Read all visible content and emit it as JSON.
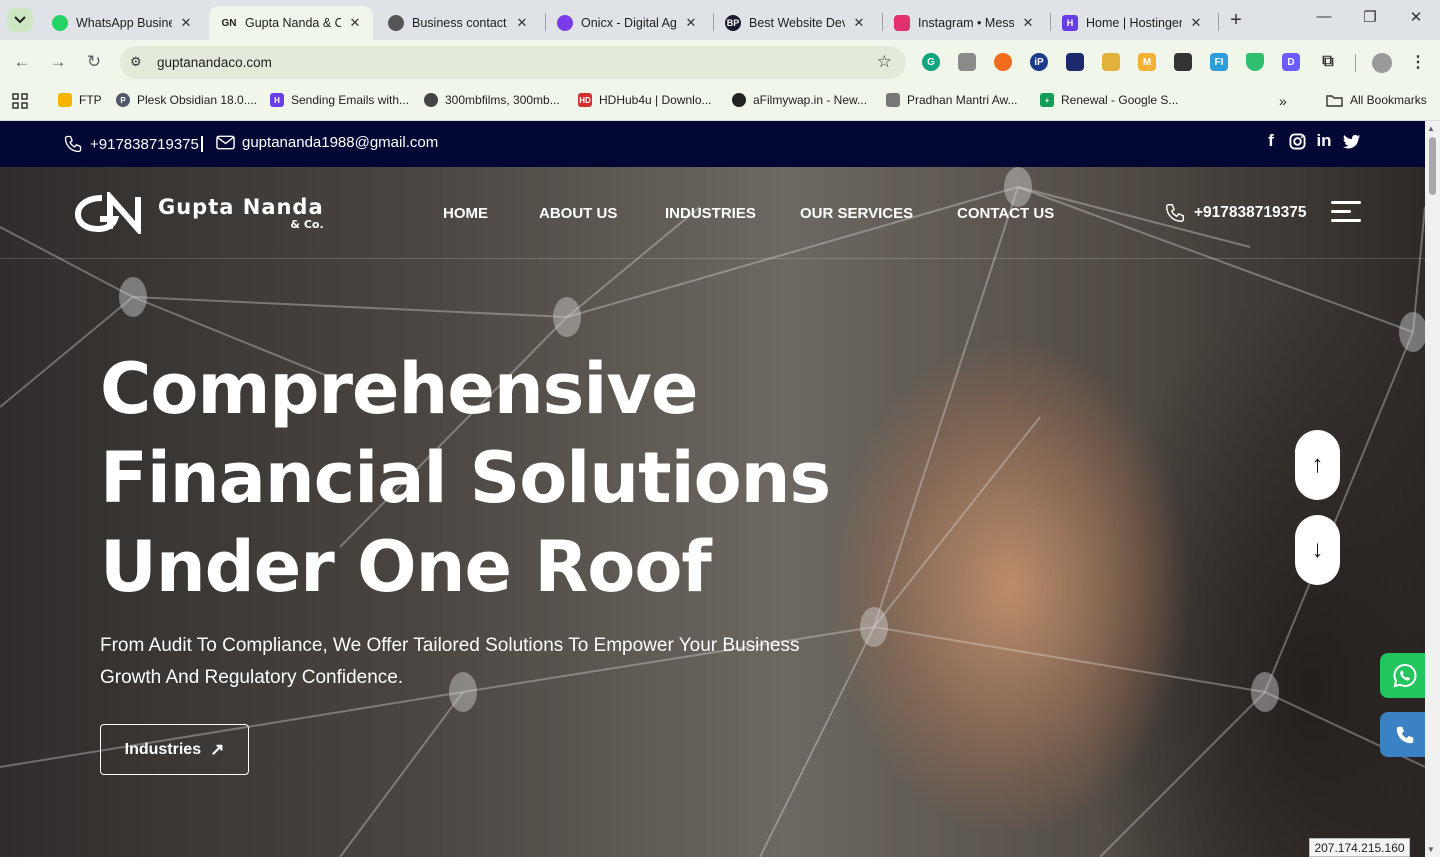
{
  "browser": {
    "tabs": [
      {
        "title": "WhatsApp Busines",
        "favicon": "whatsapp-icon",
        "color": "#25d366"
      },
      {
        "title": "Gupta Nanda & Co",
        "favicon": "gn-logo-icon",
        "color": "#222222",
        "active": true
      },
      {
        "title": "Business contact in",
        "favicon": "openai-icon",
        "color": "#333333"
      },
      {
        "title": "Onicx - Digital Age",
        "favicon": "onicx-icon",
        "color": "#7c3aed"
      },
      {
        "title": "Best Website Deve",
        "favicon": "bp-icon",
        "color": "#1a1a2e"
      },
      {
        "title": "Instagram • Messa",
        "favicon": "instagram-icon",
        "color": "#e1306c"
      },
      {
        "title": "Home | Hostinger",
        "favicon": "hostinger-icon",
        "color": "#673de6"
      }
    ],
    "url": "guptanandaco.com",
    "bookmarks": [
      {
        "label": "FTP",
        "color": "#f5b400"
      },
      {
        "label": "Plesk Obsidian 18.0....",
        "color": "#52586b"
      },
      {
        "label": "Sending Emails with...",
        "color": "#673de6"
      },
      {
        "label": "300mbfilms, 300mb...",
        "color": "#444444"
      },
      {
        "label": "HDHub4u | Downlo...",
        "color": "#d32f2f"
      },
      {
        "label": "aFilmywap.in - New...",
        "color": "#222222"
      },
      {
        "label": "Pradhan Mantri Aw...",
        "color": "#777777"
      },
      {
        "label": "Renewal - Google S...",
        "color": "#0f9d58"
      }
    ],
    "all_bookmarks": "All Bookmarks",
    "ip_badge": "207.174.215.160"
  },
  "site": {
    "topbar": {
      "phone": "+917838719375",
      "email": "guptananda1988@gmail.com",
      "socials": [
        "facebook-icon",
        "instagram-icon",
        "linkedin-icon",
        "twitter-icon"
      ]
    },
    "logo": {
      "name": "Gupta Nanda",
      "suffix": "& Co."
    },
    "nav": [
      "HOME",
      "ABOUT US",
      "INDUSTRIES",
      "OUR SERVICES",
      "CONTACT US"
    ],
    "header_phone": "+917838719375",
    "hero": {
      "title_lines": [
        "Comprehensive",
        "Financial Solutions",
        "Under One Roof"
      ],
      "subtitle_lines": [
        "From Audit To Compliance, We Offer Tailored Solutions To Empower Your Business",
        "Growth And Regulatory Confidence."
      ],
      "cta": "Industries"
    },
    "colors": {
      "topbar": "#020833",
      "whatsapp": "#22c55e",
      "call": "#3b82c4"
    }
  }
}
